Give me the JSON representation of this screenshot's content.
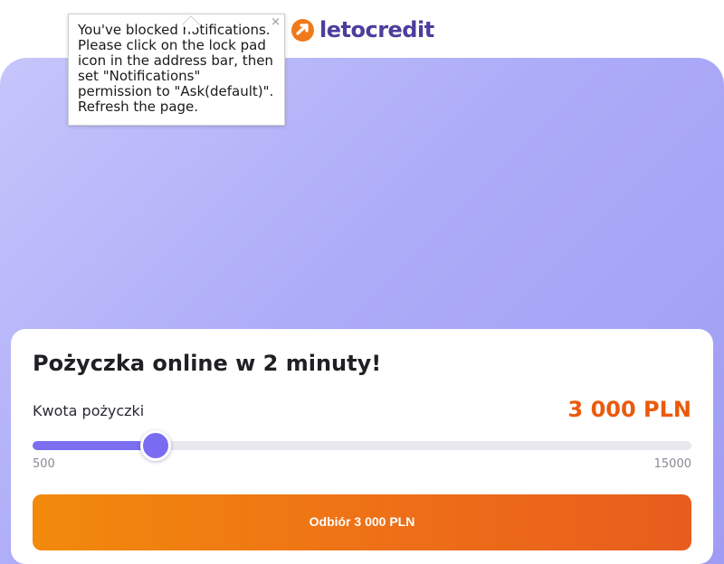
{
  "header": {
    "logo_text": "letocredit",
    "logo_icon": "letocredit-logo-icon"
  },
  "tooltip": {
    "message": "You've blocked notifications.\nPlease click on the lock pad\nicon in the address bar, then\nset \"Notifications\"\npermission to \"Ask(default)\".\nRefresh the page.",
    "close_label": "×"
  },
  "card": {
    "title": "Pożyczka online w 2 minuty!",
    "amount_label": "Kwota pożyczki",
    "amount_value": "3 000 PLN",
    "slider": {
      "min_label": "500",
      "max_label": "15000",
      "min": 500,
      "max": 15000,
      "value": 3000
    },
    "cta_label": "Odbiór 3 000 PLN"
  },
  "colors": {
    "brand_orange": "#f07a1a",
    "brand_purple": "#4b3e9c",
    "slider_accent": "#7b6ff0",
    "amount_text": "#ea5a0c"
  }
}
